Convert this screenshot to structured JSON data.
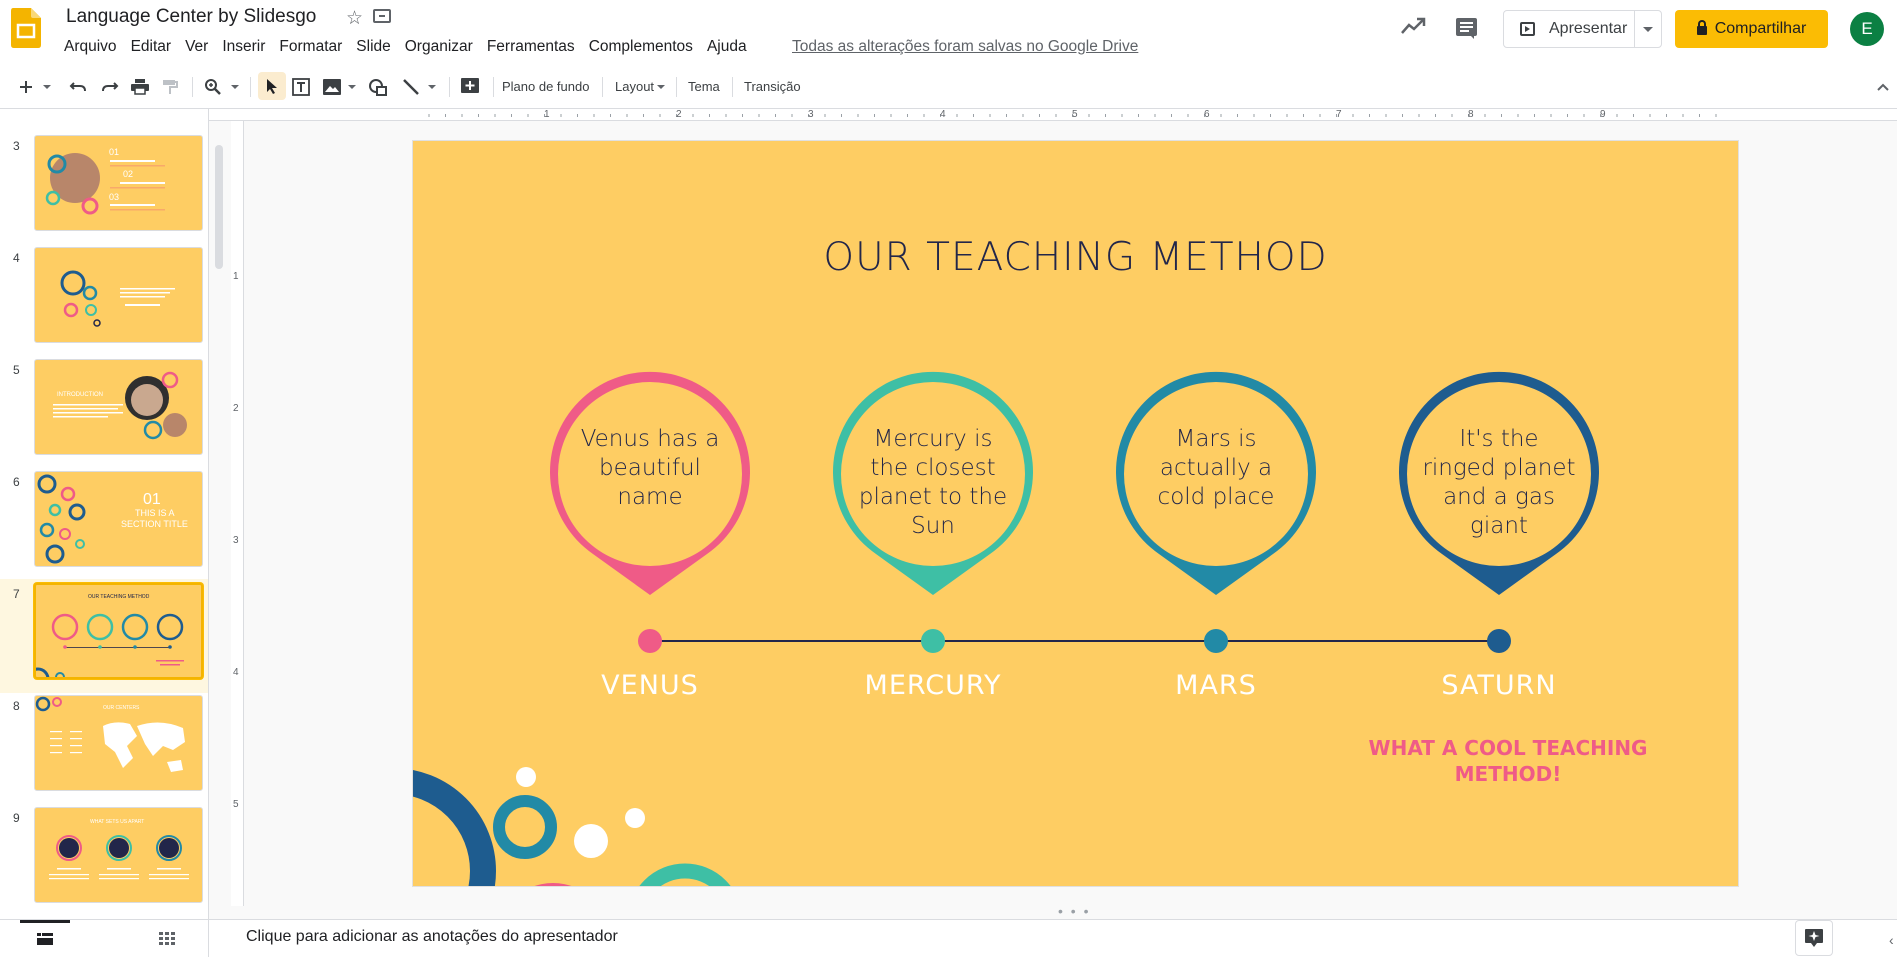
{
  "app": {
    "title": "Language Center by Slidesgo",
    "menu": [
      "Arquivo",
      "Editar",
      "Ver",
      "Inserir",
      "Formatar",
      "Slide",
      "Organizar",
      "Ferramentas",
      "Complementos",
      "Ajuda"
    ],
    "save_status": "Todas as alterações foram salvas no Google Drive",
    "present_label": "Apresentar",
    "share_label": "Compartilhar",
    "avatar_initial": "E",
    "accent_color": "#fbbc04",
    "avatar_color": "#0b8043"
  },
  "toolbar": {
    "background_label": "Plano de fundo",
    "layout_label": "Layout",
    "theme_label": "Tema",
    "transition_label": "Transição",
    "icons": [
      "new-slide-icon",
      "undo-icon",
      "redo-icon",
      "print-icon",
      "paint-format-icon",
      "zoom-icon",
      "select-icon",
      "textbox-icon",
      "image-icon",
      "shape-icon",
      "line-icon",
      "comment-add-icon",
      "collapse-icon"
    ]
  },
  "filmstrip": {
    "slides": [
      {
        "num": "3",
        "texts": [
          "01",
          "02",
          "03"
        ]
      },
      {
        "num": "4",
        "texts": []
      },
      {
        "num": "5",
        "texts": [
          "INTRODUCTION"
        ]
      },
      {
        "num": "6",
        "texts": [
          "01",
          "THIS IS A",
          "SECTION TITLE"
        ]
      },
      {
        "num": "7",
        "texts": [
          "OUR TEACHING METHOD"
        ],
        "selected": true
      },
      {
        "num": "8",
        "texts": [
          "OUR CENTERS"
        ]
      },
      {
        "num": "9",
        "texts": [
          "WHAT SETS US APART"
        ]
      }
    ]
  },
  "ruler": {
    "horizontal": [
      "1",
      "2",
      "3",
      "4",
      "5",
      "6",
      "7",
      "8",
      "9"
    ],
    "vertical": [
      "1",
      "2",
      "3",
      "4",
      "5"
    ]
  },
  "slide": {
    "title": "OUR TEACHING METHOD",
    "background": "#fecd63",
    "text_color": "#22264a",
    "planets": [
      {
        "name": "VENUS",
        "text": "Venus has a beautiful name",
        "color": "#ef5b87"
      },
      {
        "name": "MERCURY",
        "text": "Mercury is the closest planet to the Sun",
        "color": "#3ebfa5"
      },
      {
        "name": "MARS",
        "text": "Mars is actually a cold place",
        "color": "#228aa6"
      },
      {
        "name": "SATURN",
        "text": "It's the ringed planet and a gas giant",
        "color": "#1e5c8f"
      }
    ],
    "cool_method": "WHAT A COOL TEACHING METHOD!"
  },
  "notes": {
    "placeholder": "Clique para adicionar as anotações do apresentador"
  }
}
